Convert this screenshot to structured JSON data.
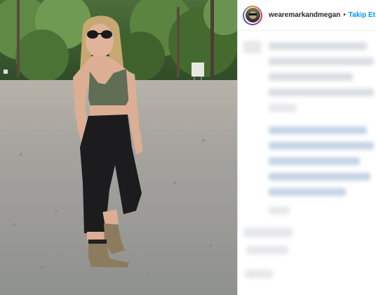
{
  "post": {
    "username": "wearemarkandmegan",
    "separator": "•",
    "follow_label": "Takip Et",
    "colors": {
      "follow_link": "#0095f6",
      "username_text": "#262626",
      "divider": "#dbdbdb"
    }
  },
  "icons": {
    "avatar": "profile-avatar-icon"
  }
}
